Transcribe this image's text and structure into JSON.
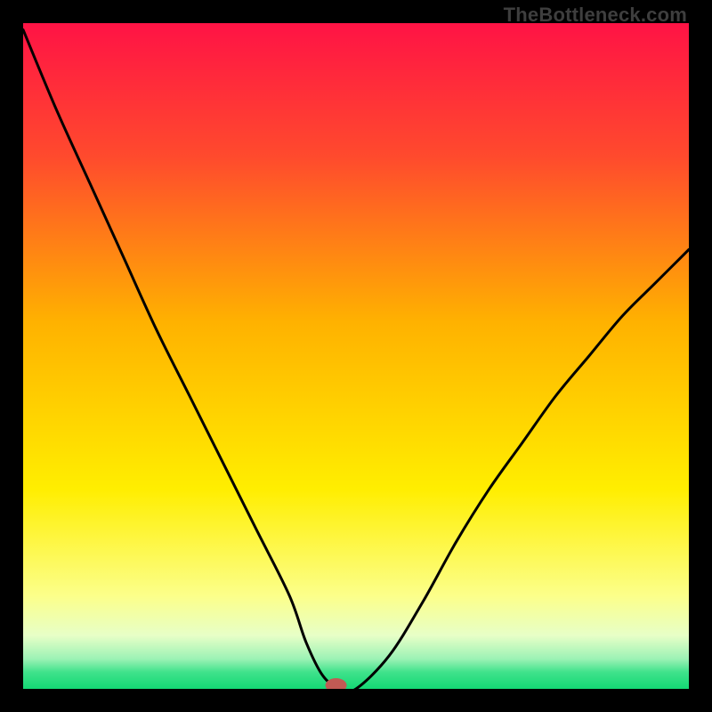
{
  "watermark": "TheBottleneck.com",
  "chart_data": {
    "type": "line",
    "title": "",
    "xlabel": "",
    "ylabel": "",
    "xlim": [
      0,
      100
    ],
    "ylim": [
      0,
      100
    ],
    "x": [
      0,
      5,
      10,
      15,
      20,
      25,
      30,
      35,
      40,
      42.5,
      45,
      47.5,
      50,
      55,
      60,
      65,
      70,
      75,
      80,
      85,
      90,
      95,
      100
    ],
    "values": [
      99,
      87,
      76,
      65,
      54,
      44,
      34,
      24,
      14,
      7,
      2,
      0,
      0,
      5,
      13,
      22,
      30,
      37,
      44,
      50,
      56,
      61,
      66
    ],
    "marker": {
      "x": 47,
      "y": 0
    },
    "gradient_stops": [
      {
        "offset": 0.0,
        "color": "#ff1345"
      },
      {
        "offset": 0.2,
        "color": "#ff4a2d"
      },
      {
        "offset": 0.45,
        "color": "#ffb200"
      },
      {
        "offset": 0.7,
        "color": "#ffee00"
      },
      {
        "offset": 0.86,
        "color": "#fcff8a"
      },
      {
        "offset": 0.92,
        "color": "#e7ffc7"
      },
      {
        "offset": 0.955,
        "color": "#9cf2b5"
      },
      {
        "offset": 0.975,
        "color": "#3fe28b"
      },
      {
        "offset": 1.0,
        "color": "#14d874"
      }
    ]
  }
}
